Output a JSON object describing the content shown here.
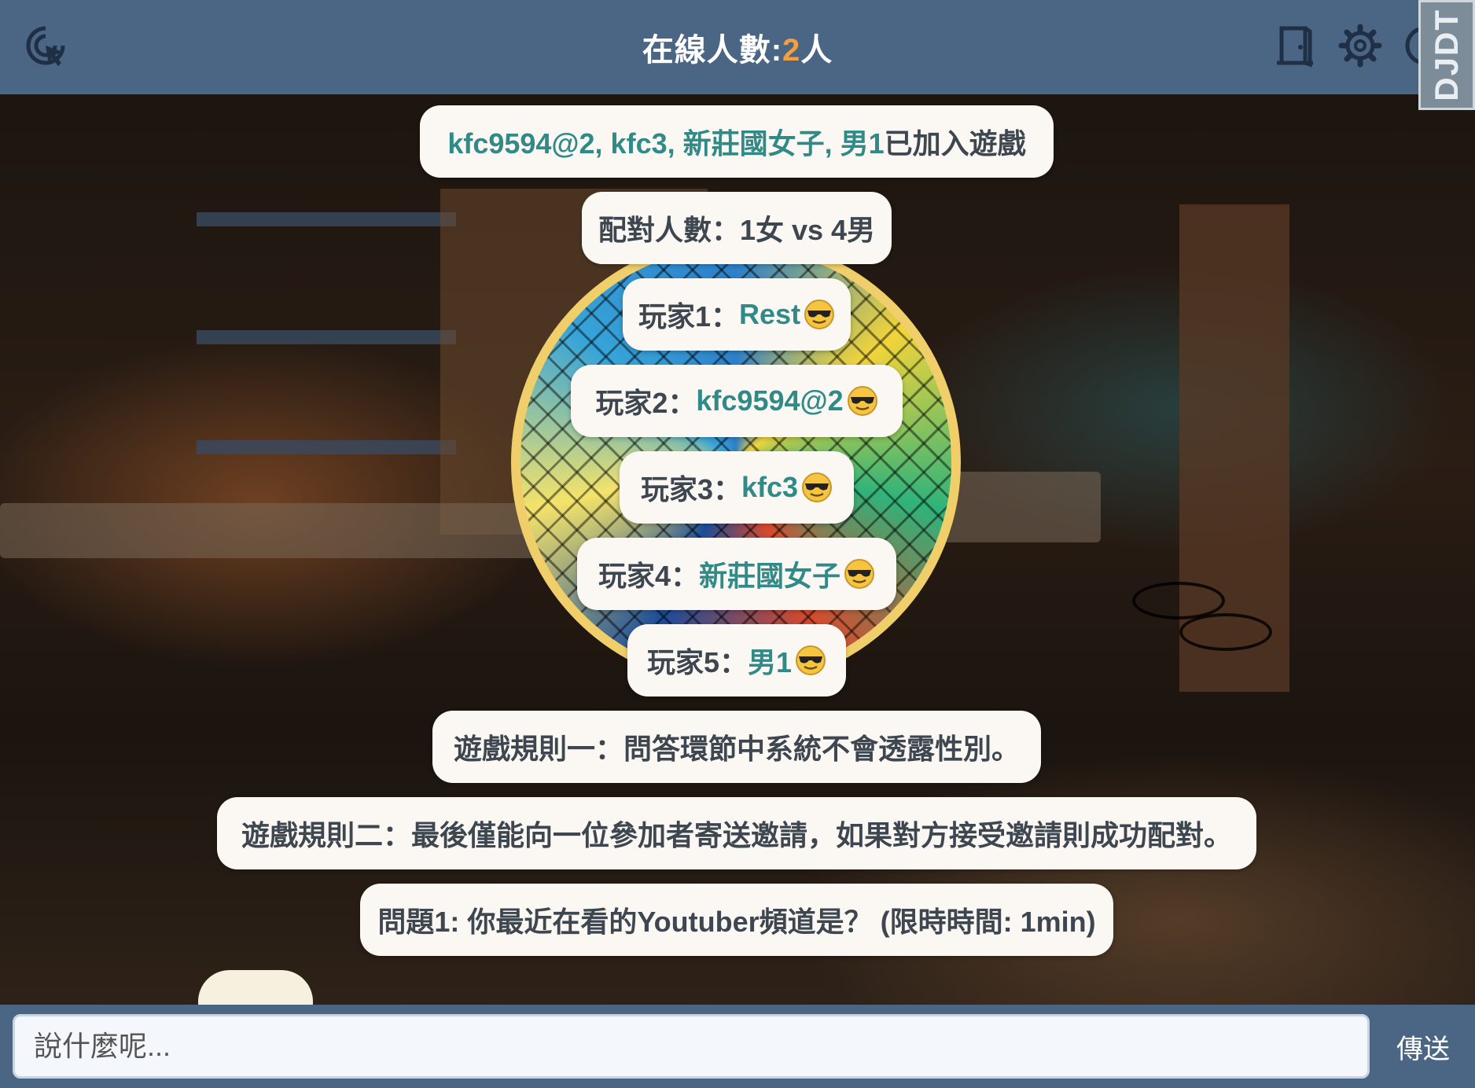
{
  "header": {
    "title_prefix": "在線人數:",
    "online_count": "2",
    "title_suffix": "人",
    "logo_text": "DJDT",
    "accent_color": "#f3a03c",
    "bar_color": "#4b6585"
  },
  "icons": {
    "left": "cursor-click-icon",
    "door": "door-exit-icon",
    "settings": "gear-icon"
  },
  "messages": {
    "join": {
      "names": "kfc9594@2, kfc3, 新莊國女子, 男1",
      "suffix": " 已加入遊戲"
    },
    "pairing": "配對人數：1女 vs 4男",
    "players": [
      {
        "label": "玩家1：",
        "name": "Rest"
      },
      {
        "label": "玩家2：",
        "name": "kfc9594@2"
      },
      {
        "label": "玩家3：",
        "name": "kfc3"
      },
      {
        "label": "玩家4：",
        "name": "新莊國女子"
      },
      {
        "label": "玩家5：",
        "name": "男1"
      }
    ],
    "rule1": "遊戲規則一：問答環節中系統不會透露性別。",
    "rule2": "遊戲規則二：最後僅能向一位參加者寄送邀請，如果對方接受邀請則成功配對。",
    "question": "問題1: 你最近在看的Youtuber頻道是？ (限時時間: 1min)"
  },
  "composer": {
    "placeholder": "說什麼呢...",
    "value": "",
    "send_label": "傳送"
  }
}
